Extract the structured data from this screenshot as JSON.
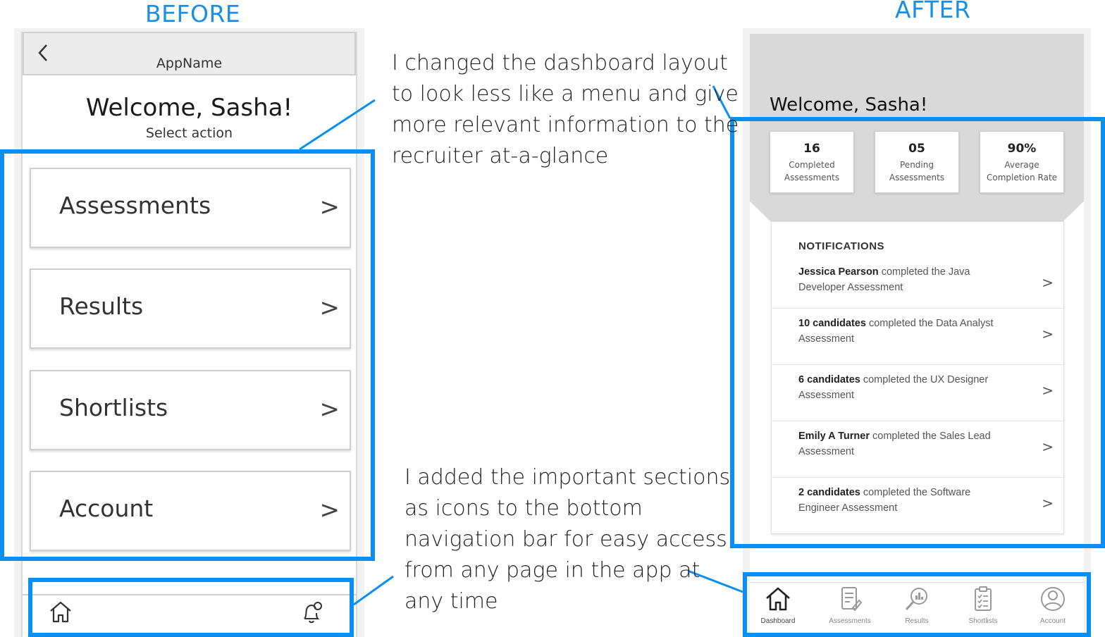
{
  "labels": {
    "before": "BEFORE",
    "after": "AFTER"
  },
  "notes": {
    "dashboard": [
      "I changed the dashboard layout",
      "to look less like a menu and give",
      "more relevant information to the",
      "recruiter at-a-glance"
    ],
    "navigation": [
      "I added the important sections",
      "as icons to the bottom",
      "navigation bar for easy access",
      "from any page in the app at",
      "any time"
    ]
  },
  "before_screen": {
    "app_name": "AppName",
    "back_icon": "chevron-left-icon",
    "welcome": "Welcome, Sasha!",
    "subtitle": "Select action",
    "menu": [
      "Assessments",
      "Results",
      "Shortlists",
      "Account"
    ],
    "chevron": ">",
    "nav_icons": [
      "home-icon",
      "bell-settings-icon"
    ]
  },
  "after_screen": {
    "welcome": "Welcome, Sasha!",
    "stats": [
      {
        "value": "16",
        "caption": [
          "Completed",
          "Assessments"
        ]
      },
      {
        "value": "05",
        "caption": [
          "Pending",
          "Assessments"
        ]
      },
      {
        "value": "90%",
        "caption": [
          "Average",
          "Completion Rate"
        ]
      }
    ],
    "notifications_title": "NOTIFICATIONS",
    "notifications": [
      {
        "name": "Jessica Pearson",
        "line1": " completed the Java",
        "line2": "Developer Assessment"
      },
      {
        "name": "10 candidates",
        "line1": " completed the Data Analyst",
        "line2": "Assessment"
      },
      {
        "name": "6 candidates",
        "line1": " completed the UX Designer",
        "line2": "Assessment"
      },
      {
        "name": "Emily A Turner",
        "line1": " completed the Sales Lead",
        "line2": "Assessment"
      },
      {
        "name": "2 candidates",
        "line1": " completed the Software",
        "line2": "Engineer Assessment"
      }
    ],
    "chevron": ">",
    "nav": [
      {
        "label": "Dashboard",
        "icon": "home-icon",
        "active": true
      },
      {
        "label": "Assessments",
        "icon": "document-edit-icon",
        "active": false
      },
      {
        "label": "Results",
        "icon": "magnifier-chart-icon",
        "active": false
      },
      {
        "label": "Shortlists",
        "icon": "clipboard-list-icon",
        "active": false
      },
      {
        "label": "Account",
        "icon": "user-circle-icon",
        "active": false
      }
    ]
  },
  "colors": {
    "highlight": "#0b8ff2",
    "heading": "#1a8fe6",
    "after_header_bg": "#d9d9d9"
  }
}
